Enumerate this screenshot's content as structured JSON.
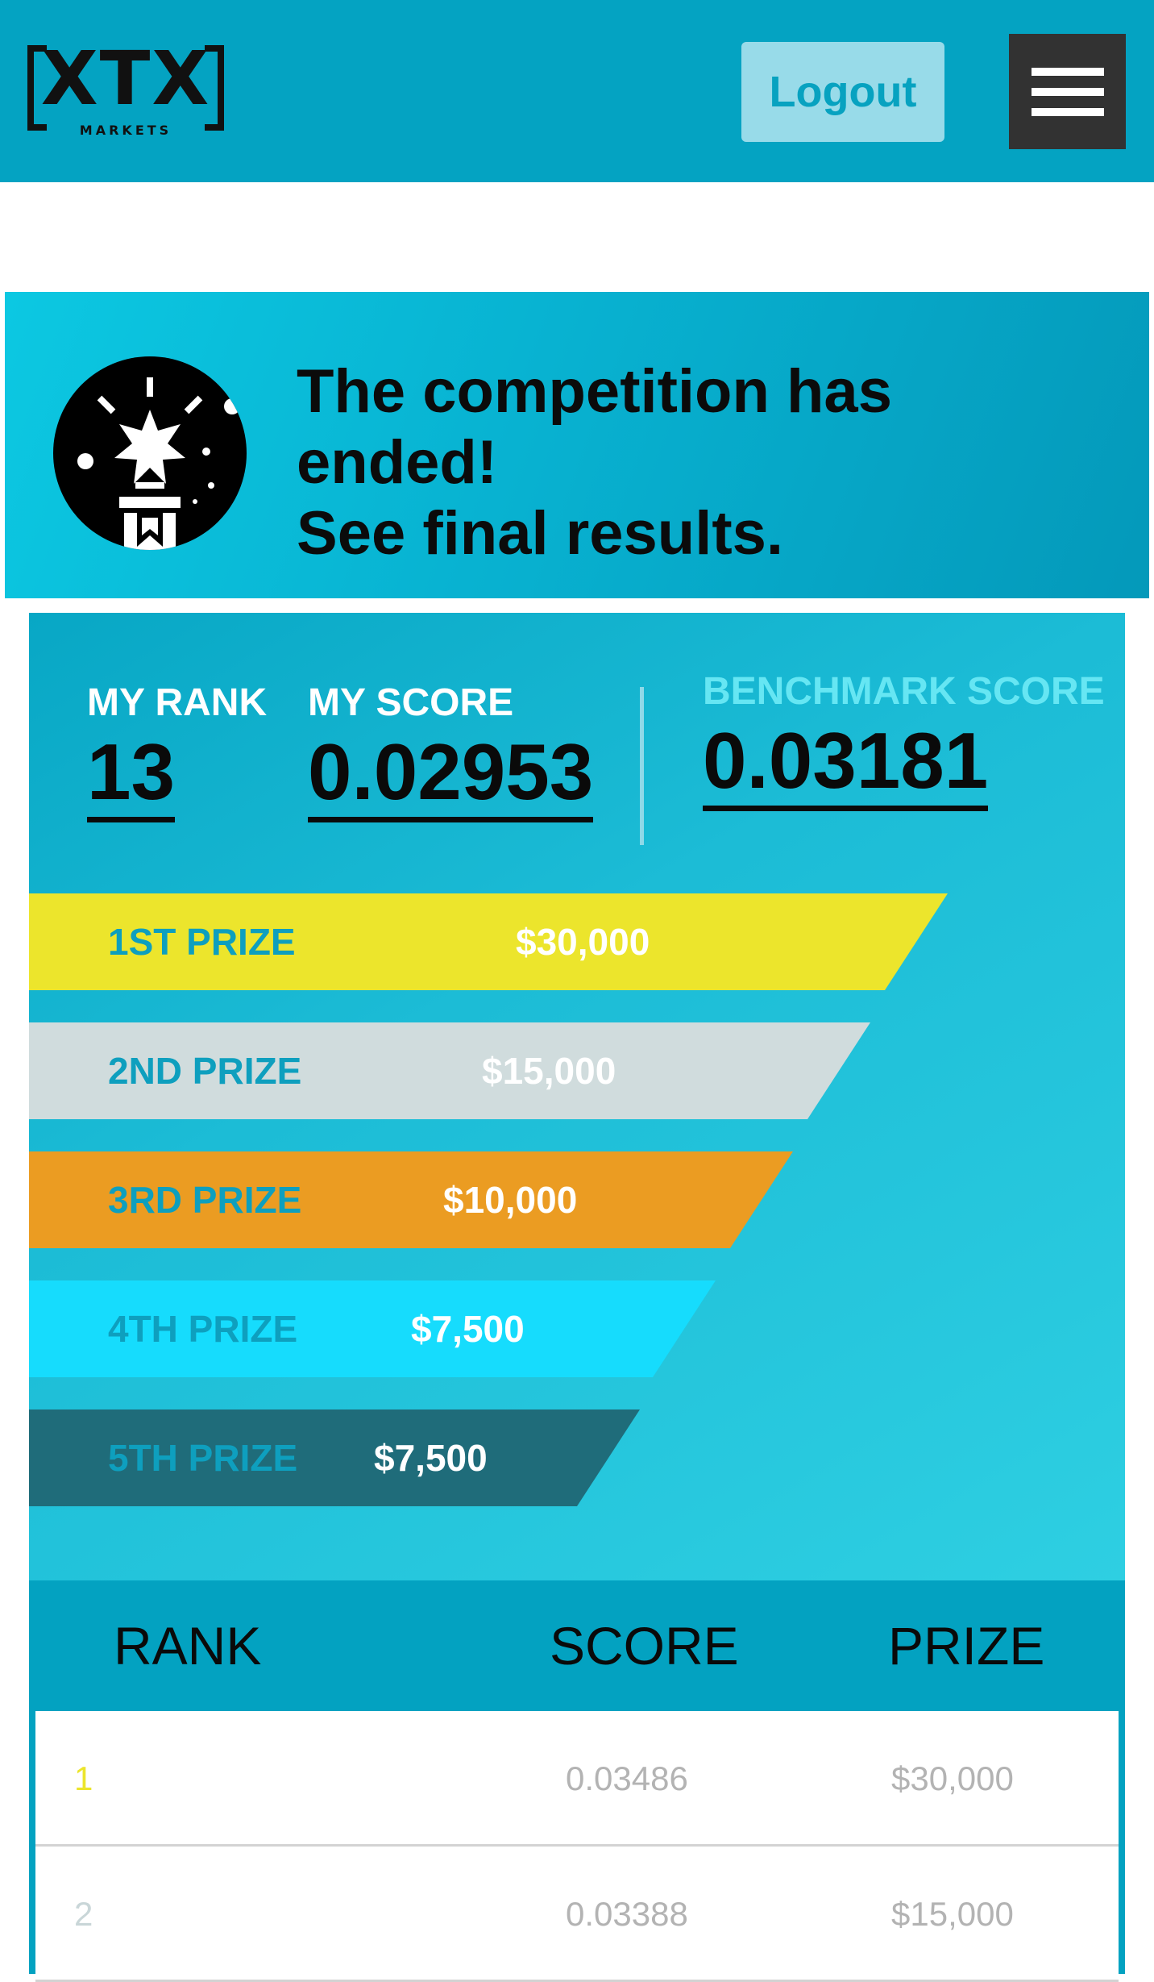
{
  "header": {
    "logo_text": "XTX",
    "logo_subtext": "MARKETS",
    "logout_label": "Logout"
  },
  "banner": {
    "line1": "The competition has ended!",
    "line2": "See final results."
  },
  "stats": {
    "my_rank_label": "MY RANK",
    "my_rank_value": "13",
    "my_score_label": "MY SCORE",
    "my_score_value": "0.02953",
    "benchmark_label": "BENCHMARK SCORE",
    "benchmark_value": "0.03181"
  },
  "prizes": [
    {
      "label": "1ST PRIZE",
      "amount": "$30,000",
      "color": "#ece52c"
    },
    {
      "label": "2ND PRIZE",
      "amount": "$15,000",
      "color": "#d0dcdd"
    },
    {
      "label": "3RD PRIZE",
      "amount": "$10,000",
      "color": "#eb9c22"
    },
    {
      "label": "4TH PRIZE",
      "amount": "$7,500",
      "color": "#16dcfd"
    },
    {
      "label": "5TH PRIZE",
      "amount": "$7,500",
      "color": "#1f6c7a"
    }
  ],
  "table": {
    "headers": [
      "RANK",
      "SCORE",
      "PRIZE"
    ],
    "rows": [
      {
        "rank": "1",
        "score": "0.03486",
        "prize": "$30,000",
        "rank_color": "#ece52c"
      },
      {
        "rank": "2",
        "score": "0.03388",
        "prize": "$15,000",
        "rank_color": "#c9d6d8"
      }
    ]
  }
}
